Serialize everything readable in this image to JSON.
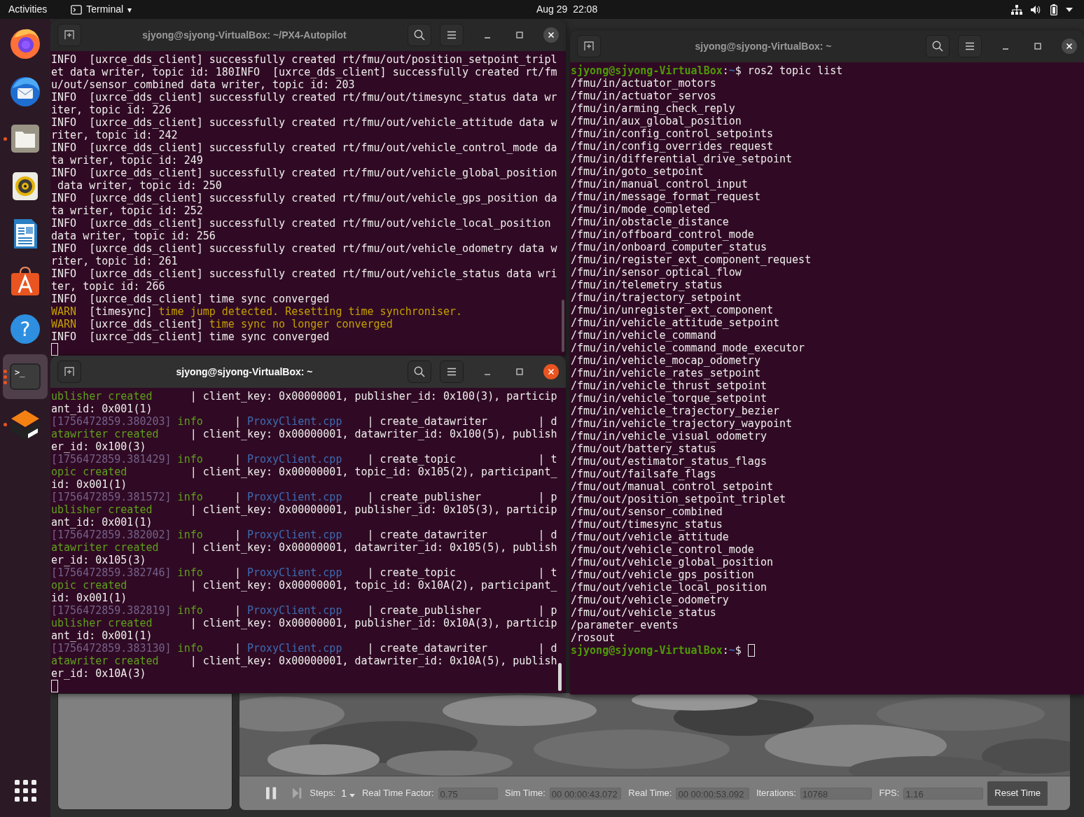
{
  "top_bar": {
    "activities": "Activities",
    "app_menu": "Terminal",
    "app_menu_caret": "▾",
    "clock": "Aug 29  22:08"
  },
  "dock": {
    "items": [
      {
        "kind": "firefox",
        "running": false,
        "selected": false
      },
      {
        "kind": "thunderbird",
        "running": false,
        "selected": false
      },
      {
        "kind": "files",
        "running": true,
        "multiple_windows": false,
        "selected": false
      },
      {
        "kind": "rhythmbox",
        "running": false,
        "selected": false
      },
      {
        "kind": "writer",
        "running": false,
        "selected": false
      },
      {
        "kind": "software",
        "running": false,
        "selected": false
      },
      {
        "kind": "help",
        "running": false,
        "selected": false,
        "glyph": "?"
      },
      {
        "kind": "terminal",
        "running": true,
        "multiple_windows": true,
        "selected": true,
        "glyph": ">_"
      },
      {
        "kind": "gazebo",
        "running": true,
        "multiple_windows": false,
        "selected": false
      }
    ]
  },
  "terminals": [
    {
      "title": "sjyong@sjyong-VirtualBox: ~/PX4-Autopilot",
      "active": false,
      "lines": [
        "INFO  [uxrce_dds_client] successfully created rt/fmu/out/position_setpoint_tripl",
        "et data writer, topic id: 180INFO  [uxrce_dds_client] successfully created rt/fm",
        "u/out/sensor_combined data writer, topic id: 203",
        "INFO  [uxrce_dds_client] successfully created rt/fmu/out/timesync_status data wr",
        "iter, topic id: 226",
        "INFO  [uxrce_dds_client] successfully created rt/fmu/out/vehicle_attitude data w",
        "riter, topic id: 242",
        "INFO  [uxrce_dds_client] successfully created rt/fmu/out/vehicle_control_mode da",
        "ta writer, topic id: 249",
        "INFO  [uxrce_dds_client] successfully created rt/fmu/out/vehicle_global_position",
        " data writer, topic id: 250",
        "INFO  [uxrce_dds_client] successfully created rt/fmu/out/vehicle_gps_position da",
        "ta writer, topic id: 252",
        "INFO  [uxrce_dds_client] successfully created rt/fmu/out/vehicle_local_position",
        "data writer, topic id: 256",
        "INFO  [uxrce_dds_client] successfully created rt/fmu/out/vehicle_odometry data w",
        "riter, topic id: 261",
        "INFO  [uxrce_dds_client] successfully created rt/fmu/out/vehicle_status data wri",
        "ter, topic id: 266",
        "INFO  [uxrce_dds_client] time sync converged",
        [
          {
            "text": "WARN  ",
            "kind": "warn"
          },
          {
            "text": "[timesync] ",
            "kind": "plain"
          },
          {
            "text": "time jump detected. Resetting time synchroniser.",
            "kind": "warn"
          }
        ],
        [
          {
            "text": "WARN  ",
            "kind": "warn"
          },
          {
            "text": "[uxrce_dds_client] ",
            "kind": "plain"
          },
          {
            "text": "time sync no longer converged",
            "kind": "warn"
          }
        ],
        "INFO  [uxrce_dds_client] time sync converged",
        [
          {
            "kind": "cursor"
          }
        ]
      ]
    },
    {
      "title": "sjyong@sjyong-VirtualBox: ~",
      "active": true,
      "lines": [
        [
          {
            "text": "ublisher created",
            "kind": "green"
          },
          {
            "text": "      | client_key: 0x00000001, publisher_id: 0x100(3), particip",
            "kind": "plain"
          }
        ],
        "ant_id: 0x001(1)",
        [
          {
            "text": "[1756472859.380203]",
            "kind": "timestamp"
          },
          {
            "text": " info",
            "kind": "green"
          },
          {
            "text": "     | ",
            "kind": "plain"
          },
          {
            "text": "ProxyClient.cpp",
            "kind": "file"
          },
          {
            "text": "    | create_datawriter        | d",
            "kind": "plain"
          }
        ],
        [
          {
            "text": "atawriter created",
            "kind": "green"
          },
          {
            "text": "     | client_key: 0x00000001, datawriter_id: 0x100(5), publish",
            "kind": "plain"
          }
        ],
        "er_id: 0x100(3)",
        [
          {
            "text": "[1756472859.381429]",
            "kind": "timestamp"
          },
          {
            "text": " info",
            "kind": "green"
          },
          {
            "text": "     | ",
            "kind": "plain"
          },
          {
            "text": "ProxyClient.cpp",
            "kind": "file"
          },
          {
            "text": "    | create_topic             | t",
            "kind": "plain"
          }
        ],
        [
          {
            "text": "opic created",
            "kind": "green"
          },
          {
            "text": "          | client_key: 0x00000001, topic_id: 0x105(2), participant_",
            "kind": "plain"
          }
        ],
        "id: 0x001(1)",
        [
          {
            "text": "[1756472859.381572]",
            "kind": "timestamp"
          },
          {
            "text": " info",
            "kind": "green"
          },
          {
            "text": "     | ",
            "kind": "plain"
          },
          {
            "text": "ProxyClient.cpp",
            "kind": "file"
          },
          {
            "text": "    | create_publisher         | p",
            "kind": "plain"
          }
        ],
        [
          {
            "text": "ublisher created",
            "kind": "green"
          },
          {
            "text": "      | client_key: 0x00000001, publisher_id: 0x105(3), particip",
            "kind": "plain"
          }
        ],
        "ant_id: 0x001(1)",
        [
          {
            "text": "[1756472859.382002]",
            "kind": "timestamp"
          },
          {
            "text": " info",
            "kind": "green"
          },
          {
            "text": "     | ",
            "kind": "plain"
          },
          {
            "text": "ProxyClient.cpp",
            "kind": "file"
          },
          {
            "text": "    | create_datawriter        | d",
            "kind": "plain"
          }
        ],
        [
          {
            "text": "atawriter created",
            "kind": "green"
          },
          {
            "text": "     | client_key: 0x00000001, datawriter_id: 0x105(5), publish",
            "kind": "plain"
          }
        ],
        "er_id: 0x105(3)",
        [
          {
            "text": "[1756472859.382746]",
            "kind": "timestamp"
          },
          {
            "text": " info",
            "kind": "green"
          },
          {
            "text": "     | ",
            "kind": "plain"
          },
          {
            "text": "ProxyClient.cpp",
            "kind": "file"
          },
          {
            "text": "    | create_topic             | t",
            "kind": "plain"
          }
        ],
        [
          {
            "text": "opic created",
            "kind": "green"
          },
          {
            "text": "          | client_key: 0x00000001, topic_id: 0x10A(2), participant_",
            "kind": "plain"
          }
        ],
        "id: 0x001(1)",
        [
          {
            "text": "[1756472859.382819]",
            "kind": "timestamp"
          },
          {
            "text": " info",
            "kind": "green"
          },
          {
            "text": "     | ",
            "kind": "plain"
          },
          {
            "text": "ProxyClient.cpp",
            "kind": "file"
          },
          {
            "text": "    | create_publisher         | p",
            "kind": "plain"
          }
        ],
        [
          {
            "text": "ublisher created",
            "kind": "green"
          },
          {
            "text": "      | client_key: 0x00000001, publisher_id: 0x10A(3), particip",
            "kind": "plain"
          }
        ],
        "ant_id: 0x001(1)",
        [
          {
            "text": "[1756472859.383130]",
            "kind": "timestamp"
          },
          {
            "text": " info",
            "kind": "green"
          },
          {
            "text": "     | ",
            "kind": "plain"
          },
          {
            "text": "ProxyClient.cpp",
            "kind": "file"
          },
          {
            "text": "    | create_datawriter        | d",
            "kind": "plain"
          }
        ],
        [
          {
            "text": "atawriter created",
            "kind": "green"
          },
          {
            "text": "     | client_key: 0x00000001, datawriter_id: 0x10A(5), publish",
            "kind": "plain"
          }
        ],
        "er_id: 0x10A(3)",
        [
          {
            "kind": "cursor"
          }
        ]
      ]
    },
    {
      "title": "sjyong@sjyong-VirtualBox: ~",
      "active": false,
      "lines": [
        [
          {
            "text": "sjyong@sjyong-VirtualBox",
            "kind": "prompt_user"
          },
          {
            "text": ":",
            "kind": "plain"
          },
          {
            "text": "~",
            "kind": "prompt_path"
          },
          {
            "text": "$ ros2 topic list",
            "kind": "plain"
          }
        ],
        "/fmu/in/actuator_motors",
        "/fmu/in/actuator_servos",
        "/fmu/in/arming_check_reply",
        "/fmu/in/aux_global_position",
        "/fmu/in/config_control_setpoints",
        "/fmu/in/config_overrides_request",
        "/fmu/in/differential_drive_setpoint",
        "/fmu/in/goto_setpoint",
        "/fmu/in/manual_control_input",
        "/fmu/in/message_format_request",
        "/fmu/in/mode_completed",
        "/fmu/in/obstacle_distance",
        "/fmu/in/offboard_control_mode",
        "/fmu/in/onboard_computer_status",
        "/fmu/in/register_ext_component_request",
        "/fmu/in/sensor_optical_flow",
        "/fmu/in/telemetry_status",
        "/fmu/in/trajectory_setpoint",
        "/fmu/in/unregister_ext_component",
        "/fmu/in/vehicle_attitude_setpoint",
        "/fmu/in/vehicle_command",
        "/fmu/in/vehicle_command_mode_executor",
        "/fmu/in/vehicle_mocap_odometry",
        "/fmu/in/vehicle_rates_setpoint",
        "/fmu/in/vehicle_thrust_setpoint",
        "/fmu/in/vehicle_torque_setpoint",
        "/fmu/in/vehicle_trajectory_bezier",
        "/fmu/in/vehicle_trajectory_waypoint",
        "/fmu/in/vehicle_visual_odometry",
        "/fmu/out/battery_status",
        "/fmu/out/estimator_status_flags",
        "/fmu/out/failsafe_flags",
        "/fmu/out/manual_control_setpoint",
        "/fmu/out/position_setpoint_triplet",
        "/fmu/out/sensor_combined",
        "/fmu/out/timesync_status",
        "/fmu/out/vehicle_attitude",
        "/fmu/out/vehicle_control_mode",
        "/fmu/out/vehicle_global_position",
        "/fmu/out/vehicle_gps_position",
        "/fmu/out/vehicle_local_position",
        "/fmu/out/vehicle_odometry",
        "/fmu/out/vehicle_status",
        "/parameter_events",
        "/rosout",
        [
          {
            "text": "sjyong@sjyong-VirtualBox",
            "kind": "prompt_user"
          },
          {
            "text": ":",
            "kind": "plain"
          },
          {
            "text": "~",
            "kind": "prompt_path"
          },
          {
            "text": "$ ",
            "kind": "plain"
          },
          {
            "kind": "cursor"
          }
        ]
      ]
    }
  ],
  "gazebo": {
    "toolbar": {
      "steps_label": "Steps:",
      "steps_value": "1",
      "fields": [
        {
          "label": "Real Time Factor:",
          "value": "0.75"
        },
        {
          "label": "Sim Time:",
          "value": "00 00:00:43.072"
        },
        {
          "label": "Real Time:",
          "value": "00 00:00:53.092"
        },
        {
          "label": "Iterations:",
          "value": "10768"
        },
        {
          "label": "FPS:",
          "value": "1.16"
        }
      ],
      "reset_button": "Reset Time"
    }
  }
}
